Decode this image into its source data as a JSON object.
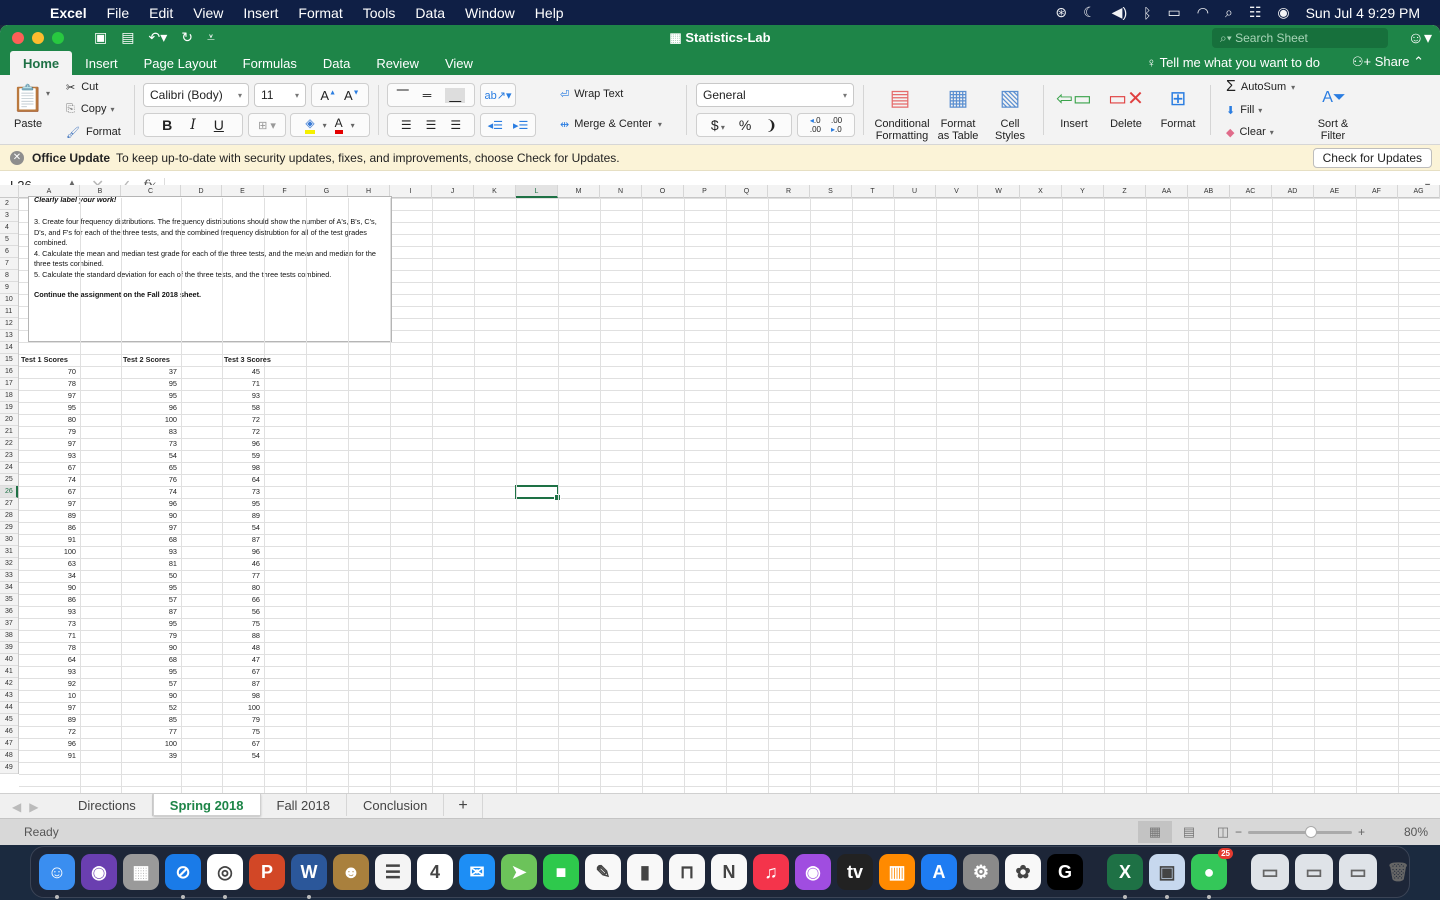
{
  "menubar": {
    "apple_icon": "apple-logo-icon",
    "app_name": "Excel",
    "items": [
      "File",
      "Edit",
      "View",
      "Insert",
      "Format",
      "Tools",
      "Data",
      "Window",
      "Help"
    ],
    "status_icons": [
      "creative-cloud-icon",
      "do-not-disturb-icon",
      "volume-icon",
      "bluetooth-off-icon",
      "battery-icon",
      "wifi-icon",
      "spotlight-icon",
      "control-center-icon",
      "siri-icon"
    ],
    "clock": "Sun Jul 4  9:29 PM"
  },
  "window": {
    "title": "Statistics-Lab",
    "search_placeholder": "Search Sheet",
    "tabs": [
      "Home",
      "Insert",
      "Page Layout",
      "Formulas",
      "Data",
      "Review",
      "View"
    ],
    "active_tab": "Home",
    "tell_me": "Tell me what you want to do",
    "share": "Share"
  },
  "ribbon": {
    "paste": "Paste",
    "cut": "Cut",
    "copy": "Copy",
    "format_painter": "Format",
    "font_name": "Calibri (Body)",
    "font_size": "11",
    "bold": "B",
    "italic": "I",
    "underline": "U",
    "wrap_text": "Wrap Text",
    "merge_center": "Merge & Center",
    "number_format": "General",
    "currency": "$",
    "percent": "%",
    "comma": "❩",
    "conditional_formatting": [
      "Conditional",
      "Formatting"
    ],
    "format_as_table": [
      "Format",
      "as Table"
    ],
    "cell_styles": [
      "Cell",
      "Styles"
    ],
    "insert": "Insert",
    "delete": "Delete",
    "format": "Format",
    "autosum": "AutoSum",
    "fill": "Fill",
    "clear": "Clear",
    "sort_filter": [
      "Sort &",
      "Filter"
    ]
  },
  "update_bar": {
    "title": "Office Update",
    "message": "To keep up-to-date with security updates, fixes, and improvements, choose Check for Updates.",
    "button": "Check for Updates"
  },
  "formula_bar": {
    "name_box": "L26",
    "fx": "fx",
    "value": ""
  },
  "grid": {
    "columns": [
      "A",
      "B",
      "C",
      "D",
      "E",
      "F",
      "G",
      "H",
      "I",
      "J",
      "K",
      "L",
      "M",
      "N",
      "O",
      "P",
      "Q",
      "R",
      "S",
      "T",
      "U",
      "V",
      "W",
      "X",
      "Y",
      "Z",
      "AA",
      "AB",
      "AC",
      "AD",
      "AE",
      "AF",
      "AG"
    ],
    "selected_column": "L",
    "first_row": 2,
    "last_row": 49,
    "selected_row": 26,
    "selected_cell": "L26"
  },
  "textbox": {
    "line0": "Clearly label your work!",
    "item3": "3.  Create four frequency distributions.  The frequency distributions should show the number of A's, B's, C's, D's, and F's for each of the three tests, and the combined frequency distrubtion for all of the test grades combined.",
    "item4": "4.  Calculate the mean and median test grade for each of the three tests, and the mean and median for the three tests combined.",
    "item5": "5.  Calculate the standard deviation for each of the three tests, and the three tests combined.",
    "continue": "Continue the assignment on the Fall 2018 sheet."
  },
  "table": {
    "headers": [
      "Test 1 Scores",
      "Test 2 Scores",
      "Test 3 Scores"
    ],
    "test1": [
      70,
      78,
      97,
      95,
      80,
      79,
      97,
      93,
      67,
      74,
      67,
      97,
      89,
      86,
      91,
      100,
      63,
      34,
      90,
      86,
      93,
      73,
      71,
      78,
      64,
      93,
      92,
      10,
      97,
      89,
      72,
      96,
      91
    ],
    "test2": [
      37,
      95,
      95,
      96,
      100,
      83,
      73,
      54,
      65,
      76,
      74,
      96,
      90,
      97,
      68,
      93,
      81,
      50,
      95,
      57,
      87,
      95,
      79,
      90,
      68,
      95,
      57,
      90,
      52,
      85,
      77,
      100,
      39
    ],
    "test3": [
      45,
      71,
      93,
      58,
      72,
      72,
      96,
      59,
      98,
      64,
      73,
      95,
      89,
      54,
      87,
      96,
      46,
      77,
      80,
      66,
      56,
      75,
      88,
      48,
      47,
      67,
      87,
      98,
      100,
      79,
      75,
      67,
      54
    ]
  },
  "sheet_tabs": [
    "Directions",
    "Spring 2018",
    "Fall 2018",
    "Conclusion"
  ],
  "active_sheet": "Spring 2018",
  "status": {
    "text": "Ready",
    "zoom": "80%",
    "zoom_level": 0.55
  },
  "dock": {
    "apps": [
      {
        "name": "finder",
        "glyph": "☺",
        "color": "#3a8ef0",
        "running": true
      },
      {
        "name": "siri",
        "glyph": "◉",
        "color": "#6a3fb0",
        "running": false
      },
      {
        "name": "launchpad",
        "glyph": "▦",
        "color": "#9a9a9a",
        "running": false
      },
      {
        "name": "safari",
        "glyph": "⊘",
        "color": "#1a7be8",
        "running": true
      },
      {
        "name": "chrome",
        "glyph": "◎",
        "color": "#ffffff",
        "running": true
      },
      {
        "name": "powerpoint",
        "glyph": "P",
        "color": "#d24726",
        "running": false
      },
      {
        "name": "word",
        "glyph": "W",
        "color": "#2b579a",
        "running": true
      },
      {
        "name": "contacts",
        "glyph": "☻",
        "color": "#a9803d",
        "running": false
      },
      {
        "name": "reminders",
        "glyph": "☰",
        "color": "#f4f4f4",
        "running": false
      },
      {
        "name": "calendar",
        "glyph": "4",
        "color": "#ffffff",
        "running": false
      },
      {
        "name": "mail",
        "glyph": "✉",
        "color": "#1d8ef5",
        "running": false
      },
      {
        "name": "maps",
        "glyph": "➤",
        "color": "#6cc35a",
        "running": false
      },
      {
        "name": "facetime",
        "glyph": "■",
        "color": "#2ec94c",
        "running": false
      },
      {
        "name": "pages",
        "glyph": "✎",
        "color": "#f8f8f8",
        "running": false
      },
      {
        "name": "numbers",
        "glyph": "▮",
        "color": "#f8f8f8",
        "running": false
      },
      {
        "name": "keynote",
        "glyph": "⊓",
        "color": "#f8f8f8",
        "running": false
      },
      {
        "name": "news",
        "glyph": "N",
        "color": "#f8f8f8",
        "running": false
      },
      {
        "name": "music",
        "glyph": "♫",
        "color": "#f4344b",
        "running": false
      },
      {
        "name": "podcasts",
        "glyph": "◉",
        "color": "#a04de0",
        "running": false
      },
      {
        "name": "apple-tv",
        "glyph": "tv",
        "color": "#222222",
        "running": false
      },
      {
        "name": "books",
        "glyph": "▥",
        "color": "#ff8a00",
        "running": false
      },
      {
        "name": "app-store",
        "glyph": "A",
        "color": "#1e7cf2",
        "running": false
      },
      {
        "name": "system-preferences",
        "glyph": "⚙",
        "color": "#8a8a8a",
        "running": false
      },
      {
        "name": "photos",
        "glyph": "✿",
        "color": "#f8f8f8",
        "running": false
      },
      {
        "name": "grammarly",
        "glyph": "G",
        "color": "#000000",
        "running": false
      }
    ],
    "running_apps": [
      {
        "name": "excel",
        "glyph": "X",
        "color": "#1e7145",
        "running": true
      },
      {
        "name": "preview",
        "glyph": "▣",
        "color": "#c7d8ee",
        "running": true
      },
      {
        "name": "messages",
        "glyph": "●",
        "color": "#34c759",
        "running": true,
        "badge": "25"
      }
    ],
    "recent": [
      "downloads-stack",
      "window-thumb-1",
      "window-thumb-2",
      "trash"
    ]
  }
}
